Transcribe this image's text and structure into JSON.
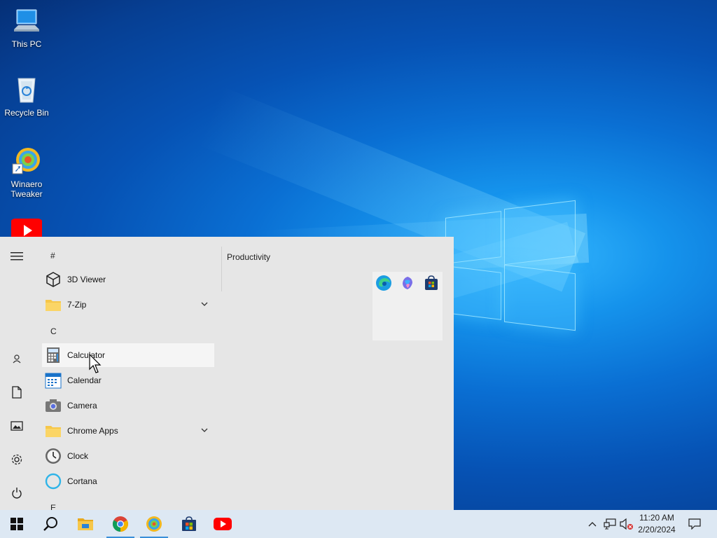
{
  "desktop": {
    "icons": [
      {
        "label": "This PC",
        "icon": "this-pc-icon"
      },
      {
        "label": "Recycle Bin",
        "icon": "recycle-bin-icon"
      },
      {
        "label_line1": "Winaero",
        "label_line2": "Tweaker",
        "icon": "winaero-tweaker-icon"
      },
      {
        "label": "",
        "icon": "youtube-icon"
      }
    ]
  },
  "start_menu": {
    "rail": [
      "hamburger-menu-icon",
      "user-icon",
      "documents-icon",
      "pictures-icon",
      "settings-icon",
      "power-icon"
    ],
    "sections": {
      "hash": "#",
      "c": "C",
      "e": "E"
    },
    "apps": [
      {
        "label": "3D Viewer",
        "icon": "3d-viewer-icon"
      },
      {
        "label": "7-Zip",
        "icon": "folder-icon",
        "expandable": true
      },
      {
        "label": "Calculator",
        "icon": "calculator-icon",
        "hovered": true
      },
      {
        "label": "Calendar",
        "icon": "calendar-icon"
      },
      {
        "label": "Camera",
        "icon": "camera-icon"
      },
      {
        "label": "Chrome Apps",
        "icon": "folder-icon",
        "expandable": true
      },
      {
        "label": "Clock",
        "icon": "clock-icon"
      },
      {
        "label": "Cortana",
        "icon": "cortana-icon"
      }
    ],
    "tiles": {
      "group_title": "Productivity",
      "folder_icons": [
        "edge-icon",
        "copilot-icon",
        "store-icon"
      ]
    }
  },
  "taskbar": {
    "apps": [
      "start-icon",
      "search-icon",
      "file-explorer-icon",
      "chrome-icon",
      "winaero-tweaker-icon",
      "microsoft-store-icon",
      "youtube-icon"
    ],
    "tray": [
      "show-hidden-icons-chevron",
      "network-icon",
      "volume-muted-icon"
    ],
    "time": "11:20 AM",
    "date": "2/20/2024",
    "notification": "action-center-icon"
  },
  "colors": {
    "accent": "#0078d7",
    "start_bg": "#e6e6e6",
    "taskbar_bg": "#dde8f3"
  }
}
